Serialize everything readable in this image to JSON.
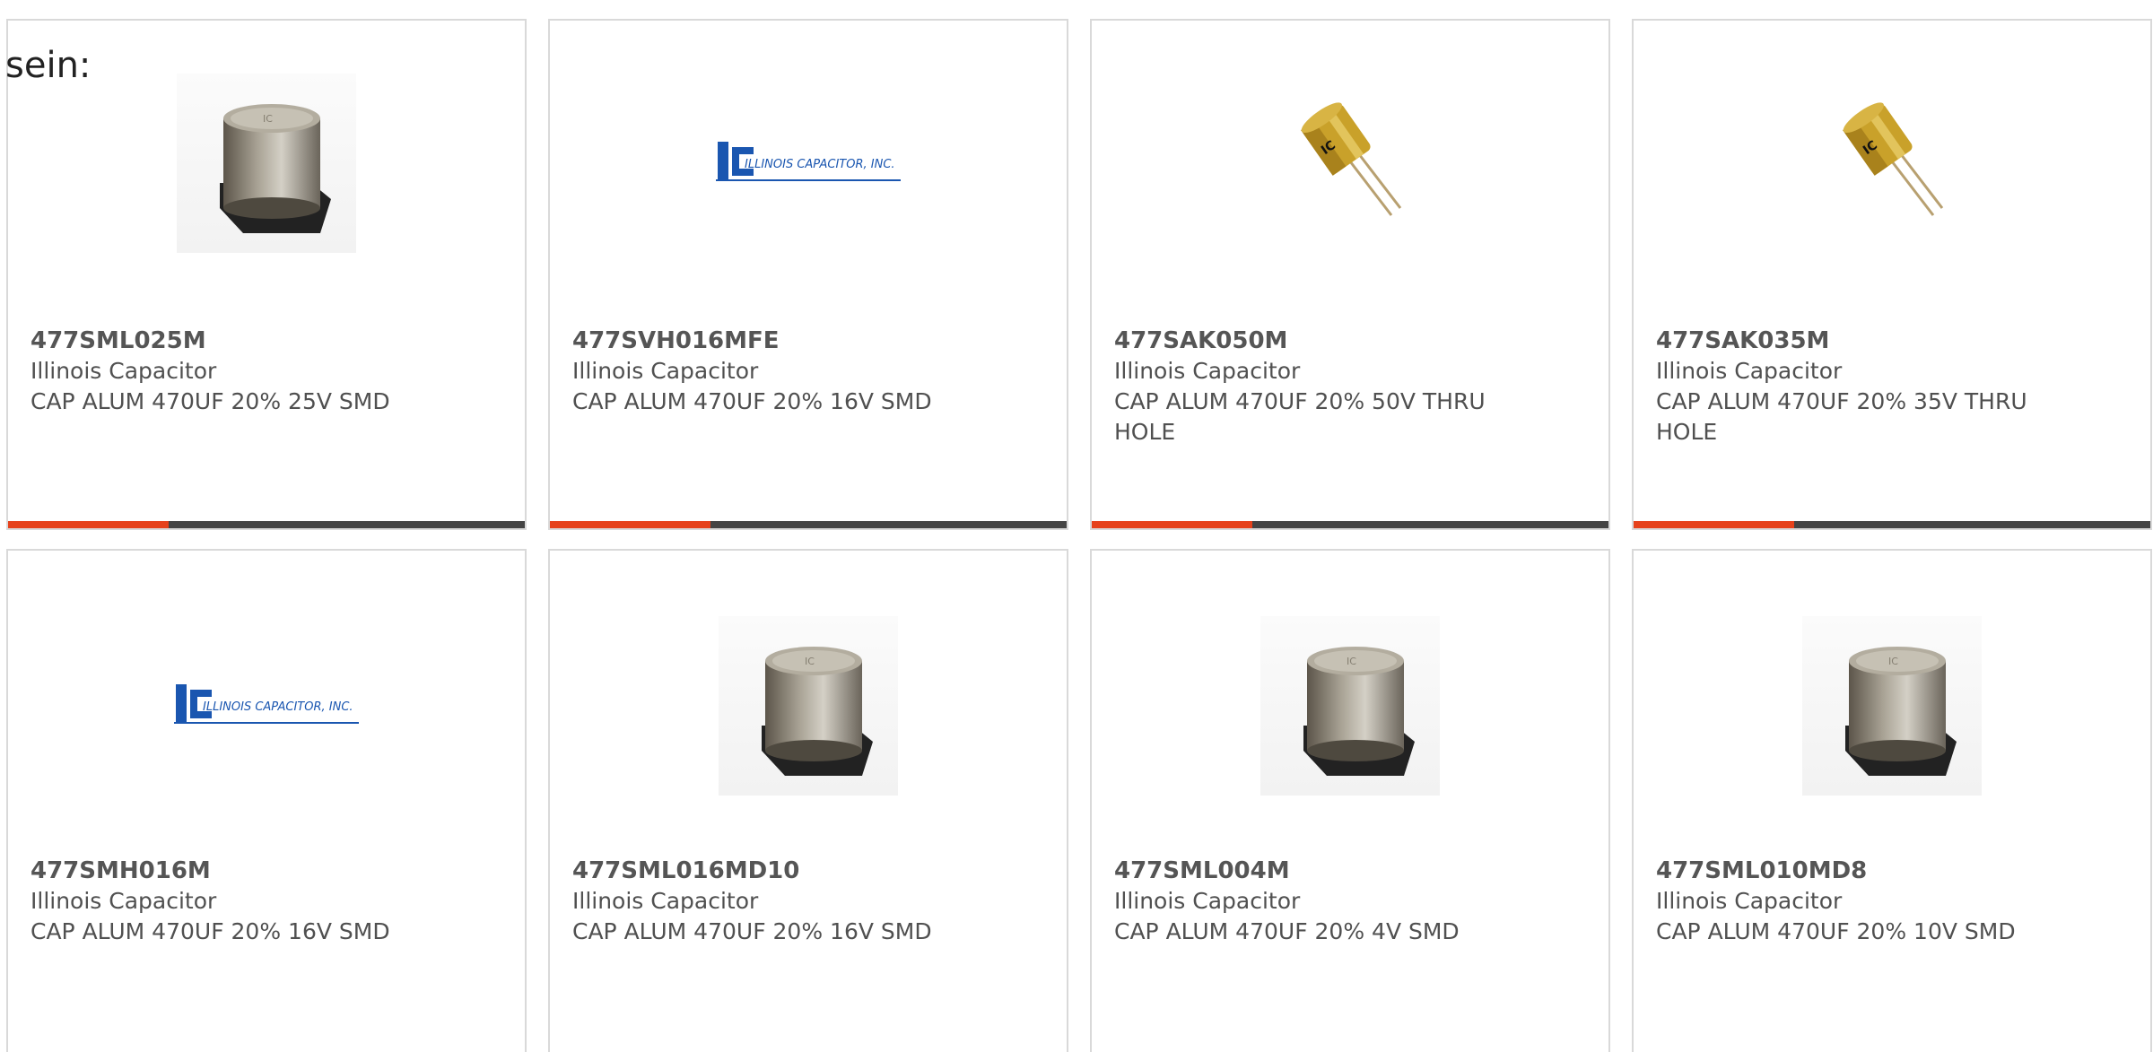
{
  "heading": "sein:",
  "colors": {
    "accent": "#e6421c",
    "track": "#444444",
    "text": "#505050",
    "logo_blue": "#1a56b0"
  },
  "products": [
    {
      "part_number": "477SML025M",
      "manufacturer": "Illinois Capacitor",
      "description": "CAP ALUM 470UF 20% 25V SMD",
      "image": "smd-capacitor-icon",
      "progress": 0.31
    },
    {
      "part_number": "477SVH016MFE",
      "manufacturer": "Illinois Capacitor",
      "description": "CAP ALUM 470UF 20% 16V SMD",
      "image": "illinois-capacitor-logo",
      "logo_text": "ILLINOIS CAPACITOR, INC.",
      "progress": 0.31
    },
    {
      "part_number": "477SAK050M",
      "manufacturer": "Illinois Capacitor",
      "description": "CAP ALUM 470UF 20% 50V THRU HOLE",
      "image": "through-hole-capacitor-icon",
      "progress": 0.31
    },
    {
      "part_number": "477SAK035M",
      "manufacturer": "Illinois Capacitor",
      "description": "CAP ALUM 470UF 20% 35V THRU HOLE",
      "image": "through-hole-capacitor-icon",
      "progress": 0.31
    },
    {
      "part_number": "477SMH016M",
      "manufacturer": "Illinois Capacitor",
      "description": "CAP ALUM 470UF 20% 16V SMD",
      "image": "illinois-capacitor-logo",
      "logo_text": "ILLINOIS CAPACITOR, INC."
    },
    {
      "part_number": "477SML016MD10",
      "manufacturer": "Illinois Capacitor",
      "description": "CAP ALUM 470UF 20% 16V SMD",
      "image": "smd-capacitor-icon"
    },
    {
      "part_number": "477SML004M",
      "manufacturer": "Illinois Capacitor",
      "description": "CAP ALUM 470UF 20% 4V SMD",
      "image": "smd-capacitor-icon"
    },
    {
      "part_number": "477SML010MD8",
      "manufacturer": "Illinois Capacitor",
      "description": "CAP ALUM 470UF 20% 10V SMD",
      "image": "smd-capacitor-icon"
    }
  ]
}
